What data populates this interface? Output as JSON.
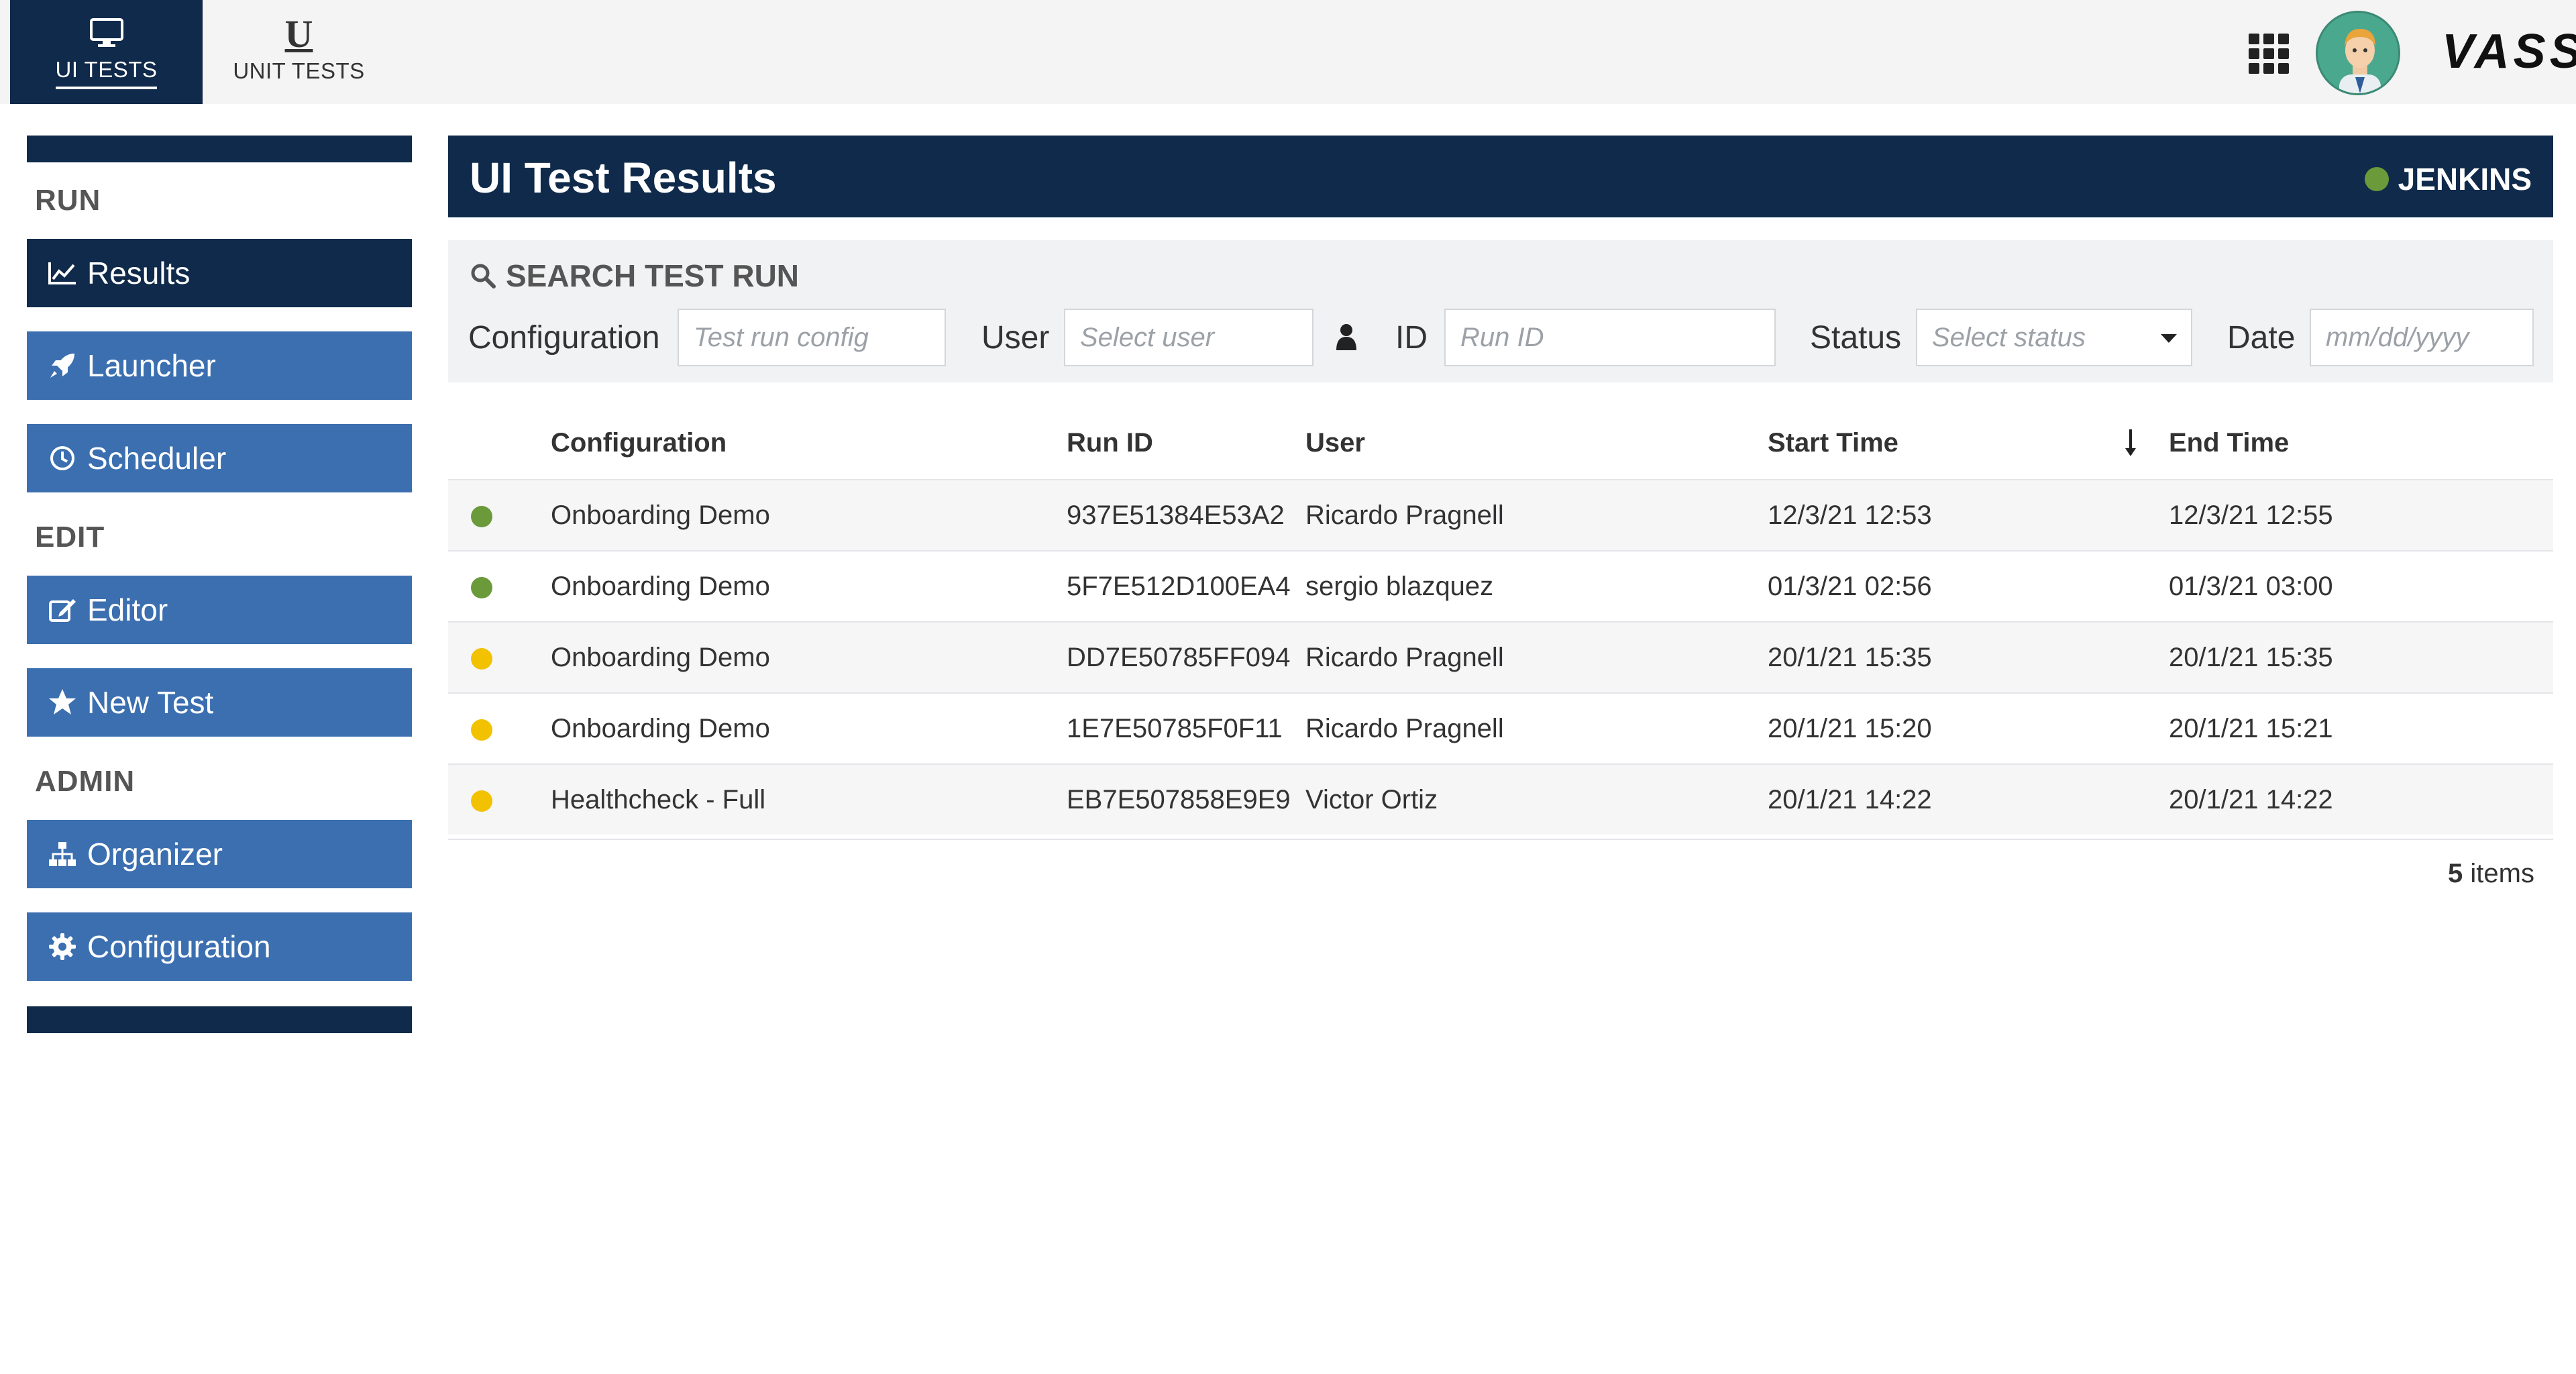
{
  "colors": {
    "navy": "#0f2a4a",
    "accent_blue": "#3b6fb0",
    "status_green": "#6a9a3a",
    "status_yellow": "#f2c200"
  },
  "topbar": {
    "tabs": [
      {
        "label": "UI TESTS",
        "icon": "monitor-icon",
        "active": true
      },
      {
        "label": "UNIT TESTS",
        "icon": "u-letter-icon",
        "active": false
      }
    ],
    "apps_icon": "grid-icon",
    "logo": "VASS"
  },
  "sidebar": {
    "sections": [
      {
        "heading": "RUN",
        "items": [
          {
            "label": "Results",
            "icon": "chart-line-icon",
            "active": true
          },
          {
            "label": "Launcher",
            "icon": "rocket-icon",
            "active": false
          },
          {
            "label": "Scheduler",
            "icon": "clock-icon",
            "active": false
          }
        ]
      },
      {
        "heading": "EDIT",
        "items": [
          {
            "label": "Editor",
            "icon": "edit-icon",
            "active": false
          },
          {
            "label": "New Test",
            "icon": "star-icon",
            "active": false
          }
        ]
      },
      {
        "heading": "ADMIN",
        "items": [
          {
            "label": "Organizer",
            "icon": "sitemap-icon",
            "active": false
          },
          {
            "label": "Configuration",
            "icon": "gear-icon",
            "active": false
          }
        ]
      }
    ]
  },
  "main": {
    "title": "UI Test Results",
    "server_status": {
      "label": "JENKINS",
      "color": "#6a9a3a"
    }
  },
  "search": {
    "title": "SEARCH TEST RUN",
    "config_label": "Configuration",
    "config_placeholder": "Test run config",
    "user_label": "User",
    "user_placeholder": "Select user",
    "id_label": "ID",
    "id_placeholder": "Run ID",
    "status_label": "Status",
    "status_placeholder": "Select status",
    "date_label": "Date",
    "date_placeholder": "mm/dd/yyyy"
  },
  "table": {
    "headers": {
      "configuration": "Configuration",
      "run_id": "Run ID",
      "user": "User",
      "start_time": "Start Time",
      "end_time": "End Time"
    },
    "sort": {
      "column": "start_time",
      "direction": "descending"
    },
    "rows": [
      {
        "status": "green",
        "configuration": "Onboarding Demo",
        "run_id": "937E51384E53A2",
        "user": "Ricardo Pragnell",
        "start_time": "12/3/21 12:53",
        "end_time": "12/3/21 12:55"
      },
      {
        "status": "green",
        "configuration": "Onboarding Demo",
        "run_id": "5F7E512D100EA4",
        "user": "sergio blazquez",
        "start_time": "01/3/21 02:56",
        "end_time": "01/3/21 03:00"
      },
      {
        "status": "yellow",
        "configuration": "Onboarding Demo",
        "run_id": "DD7E50785FF094",
        "user": "Ricardo Pragnell",
        "start_time": "20/1/21 15:35",
        "end_time": "20/1/21 15:35"
      },
      {
        "status": "yellow",
        "configuration": "Onboarding Demo",
        "run_id": "1E7E50785F0F11",
        "user": "Ricardo Pragnell",
        "start_time": "20/1/21 15:20",
        "end_time": "20/1/21 15:21"
      },
      {
        "status": "yellow",
        "configuration": "Healthcheck - Full",
        "run_id": "EB7E507858E9E9",
        "user": "Victor Ortiz",
        "start_time": "20/1/21 14:22",
        "end_time": "20/1/21 14:22"
      }
    ],
    "footer": {
      "count": "5",
      "suffix": "items"
    }
  }
}
